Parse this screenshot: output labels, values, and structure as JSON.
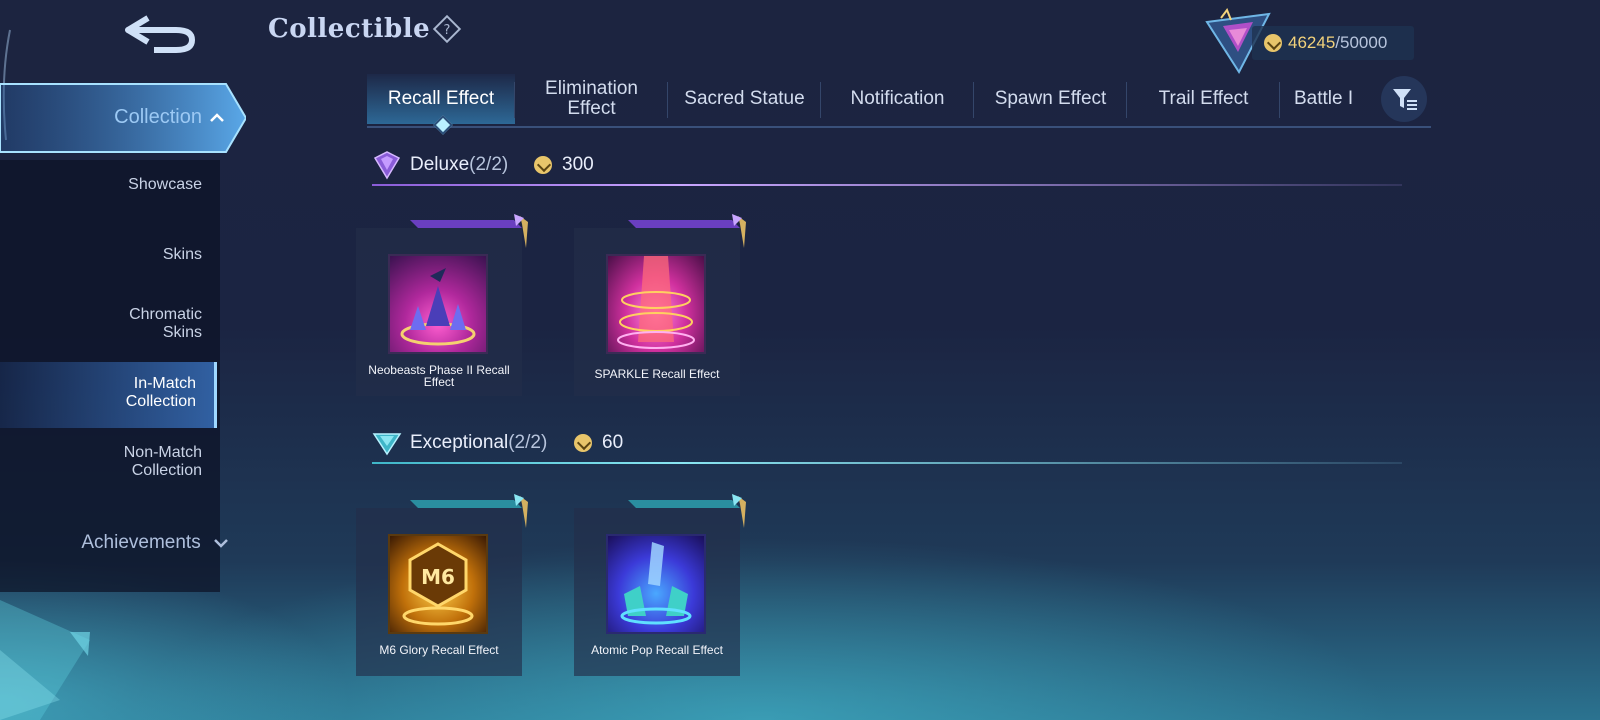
{
  "header": {
    "title": "Collectible",
    "help_icon": "question-diamond-icon"
  },
  "currency": {
    "current": "46245",
    "max": "/50000",
    "icon": "coin-icon"
  },
  "sidebar": {
    "collection": "Collection",
    "items": [
      {
        "line1": "Showcase",
        "line2": ""
      },
      {
        "line1": "Skins",
        "line2": ""
      },
      {
        "line1": "Chromatic",
        "line2": "Skins"
      },
      {
        "line1": "In-Match",
        "line2": "Collection",
        "active": true
      },
      {
        "line1": "Non-Match",
        "line2": "Collection"
      }
    ],
    "achievements": "Achievements"
  },
  "tabs": [
    {
      "line1": "Recall Effect",
      "line2": "",
      "active": true
    },
    {
      "line1": "Elimination",
      "line2": "Effect"
    },
    {
      "line1": "Sacred Statue",
      "line2": ""
    },
    {
      "line1": "Notification",
      "line2": ""
    },
    {
      "line1": "Spawn Effect",
      "line2": ""
    },
    {
      "line1": "Trail Effect",
      "line2": ""
    },
    {
      "line1": "Battle I",
      "line2": ""
    }
  ],
  "sections": [
    {
      "name": "Deluxe",
      "count": "(2/2)",
      "price": "300",
      "accent": "#8a5cd8",
      "items": [
        {
          "line1": "Neobeasts Phase II Recall",
          "line2": "Effect"
        },
        {
          "line1": "SPARKLE Recall Effect",
          "line2": ""
        }
      ]
    },
    {
      "name": "Exceptional",
      "count": "(2/2)",
      "price": "60",
      "accent": "#3fb6c8",
      "items": [
        {
          "line1": "M6 Glory Recall Effect",
          "line2": ""
        },
        {
          "line1": "Atomic Pop Recall Effect",
          "line2": ""
        }
      ]
    }
  ],
  "thumb_text": {
    "m6": "M6"
  },
  "colors": {
    "accent_gold": "#f2d27b",
    "active_tab": "#4fb2e0",
    "deluxe": "#8a5cd8",
    "exceptional": "#3fb6c8"
  }
}
